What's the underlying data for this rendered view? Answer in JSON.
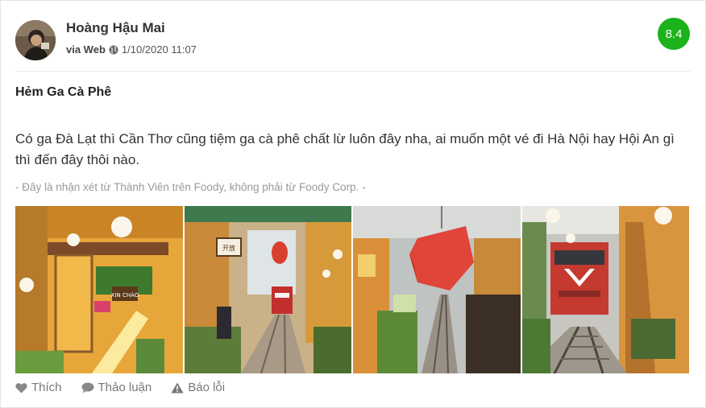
{
  "post": {
    "user_name": "Hoàng Hậu Mai",
    "via_label": "via Web",
    "timestamp": "1/10/2020 11:07",
    "score": "8.4",
    "score_color": "#1bb21b",
    "title": "Hẻm Ga Cà Phê",
    "body": "Có ga Đà Lạt thì Cần Thơ cũng tiệm ga cà phê chất lừ luôn đây nha, ai muốn một vé đi Hà Nội hay Hội An gì thì đến đây thôi nào.",
    "disclaimer": "- Đây là nhận xét từ Thành Viên trên Foody, không phải từ Foody Corp. -"
  },
  "photos": [
    {
      "name": "cafe-photo-1",
      "sign_text": "XIN CHÀO"
    },
    {
      "name": "cafe-photo-2",
      "sign_text": "开放"
    },
    {
      "name": "cafe-photo-3"
    },
    {
      "name": "cafe-photo-4"
    }
  ],
  "actions": {
    "like_label": "Thích",
    "like_icon": "heart-icon",
    "discuss_label": "Thảo luận",
    "discuss_icon": "comment-icon",
    "report_label": "Báo lỗi",
    "report_icon": "warning-icon"
  }
}
